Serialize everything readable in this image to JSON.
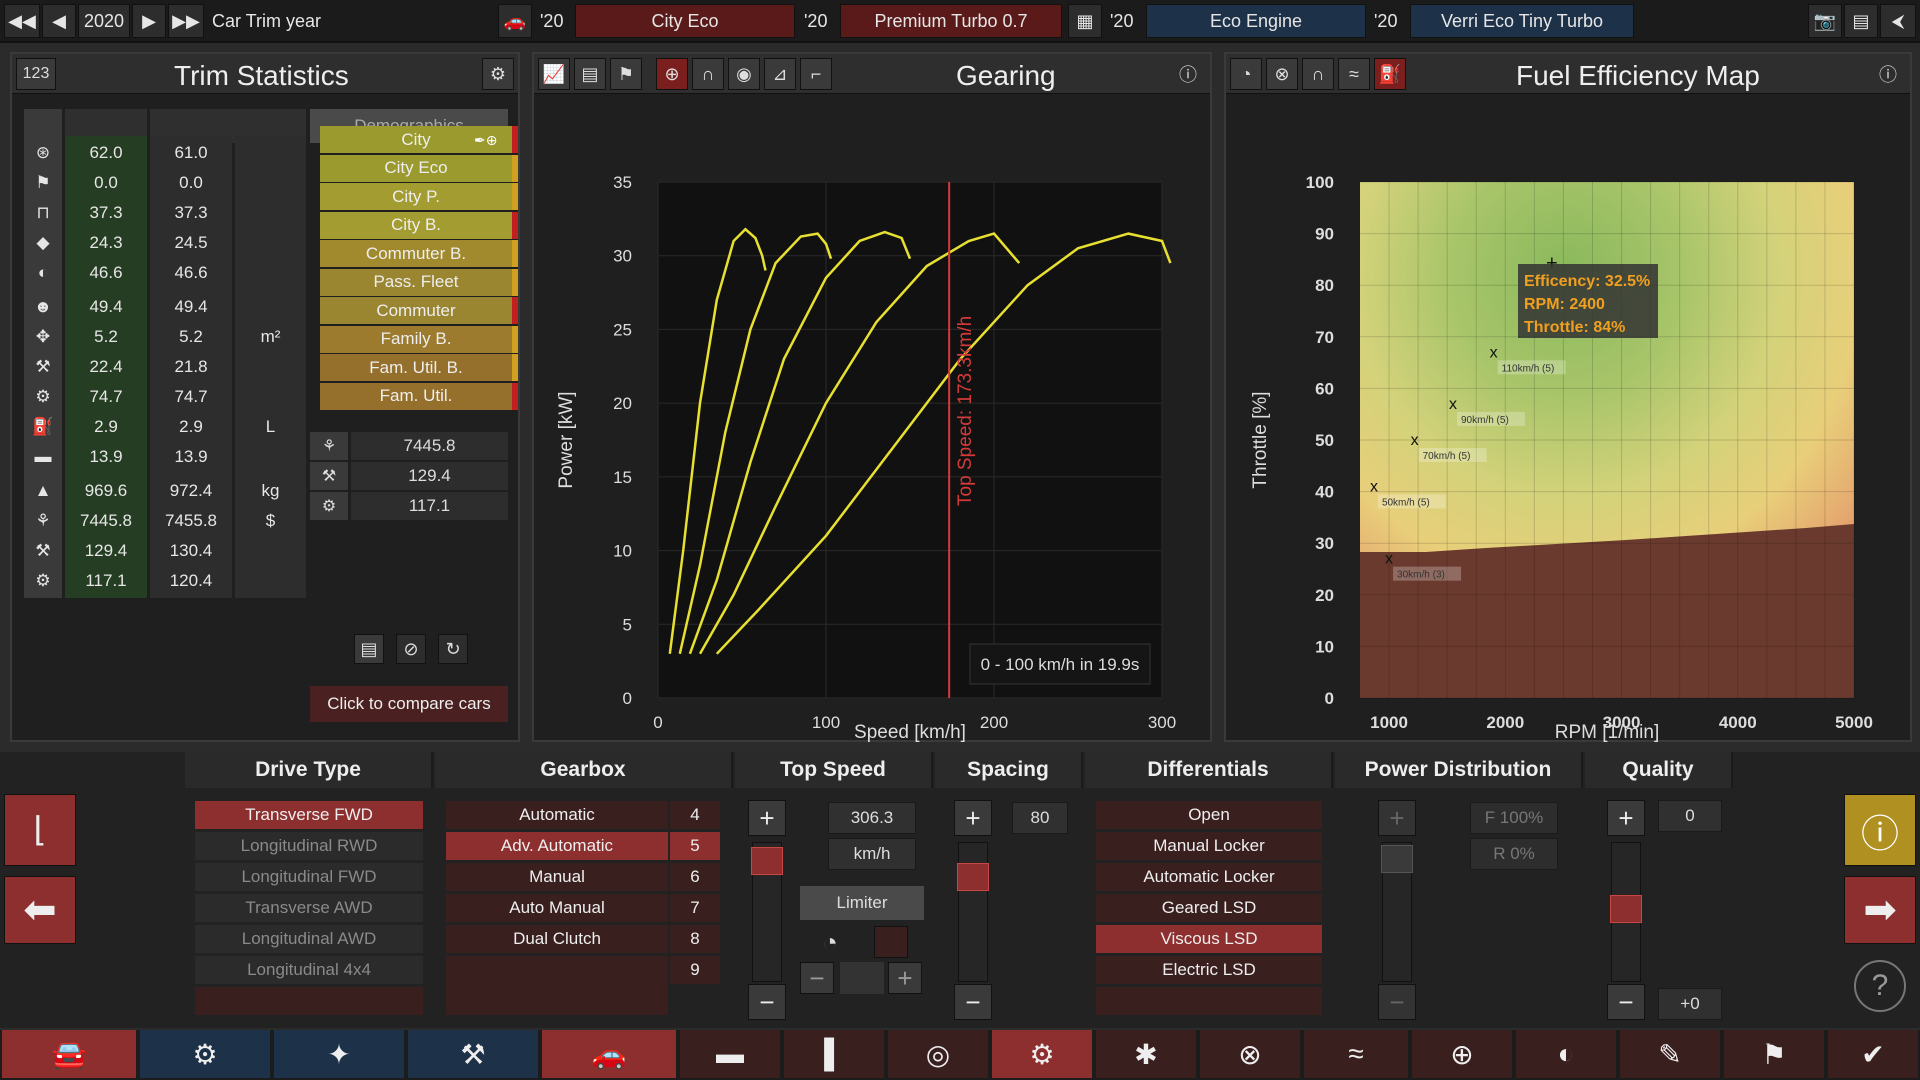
{
  "topbar": {
    "year": "2020",
    "year_label": "Car Trim year",
    "yr1": "'20",
    "trim": "City Eco",
    "yr2": "'20",
    "body": "Premium Turbo 0.7",
    "yr3": "'20",
    "engine_family": "Eco Engine",
    "yr4": "'20",
    "engine": "Verri Eco Tiny Turbo"
  },
  "stats": {
    "title": "Trim Statistics",
    "id": "123",
    "demographics_label": "Demographics",
    "rows": [
      {
        "icon": "steering-wheel-icon",
        "v1": "62.0",
        "v2": "61.0",
        "unit": ""
      },
      {
        "icon": "checkered-flag-icon",
        "v1": "0.0",
        "v2": "0.0",
        "unit": ""
      },
      {
        "icon": "seat-icon",
        "v1": "37.3",
        "v2": "37.3",
        "unit": ""
      },
      {
        "icon": "gem-icon",
        "v1": "24.3",
        "v2": "24.5",
        "unit": ""
      },
      {
        "icon": "safety-icon",
        "v1": "46.6",
        "v2": "46.6",
        "unit": ""
      },
      {
        "icon": "passengers-icon",
        "v1": "49.4",
        "v2": "49.4",
        "unit": ""
      },
      {
        "icon": "cargo-icon",
        "v1": "5.2",
        "v2": "5.2",
        "unit": "m²"
      },
      {
        "icon": "offroad-icon",
        "v1": "22.4",
        "v2": "21.8",
        "unit": ""
      },
      {
        "icon": "reliability-icon",
        "v1": "74.7",
        "v2": "74.7",
        "unit": ""
      },
      {
        "icon": "fuel-icon",
        "v1": "2.9",
        "v2": "2.9",
        "unit": "L"
      },
      {
        "icon": "truck-icon",
        "v1": "13.9",
        "v2": "13.9",
        "unit": ""
      },
      {
        "icon": "weight-icon",
        "v1": "969.6",
        "v2": "972.4",
        "unit": "kg"
      },
      {
        "icon": "cost-icon",
        "v1": "7445.8",
        "v2": "7455.8",
        "unit": "$"
      },
      {
        "icon": "engineering-icon",
        "v1": "129.4",
        "v2": "130.4",
        "unit": ""
      },
      {
        "icon": "production-icon",
        "v1": "117.1",
        "v2": "120.4",
        "unit": ""
      }
    ],
    "demos": [
      "City",
      "City Eco",
      "City P.",
      "City B.",
      "Commuter B.",
      "Pass. Fleet",
      "Commuter",
      "Family B.",
      "Fam. Util. B.",
      "Fam. Util."
    ],
    "demo_colors": [
      "#9a9a2e",
      "#9a9a2e",
      "#a39c30",
      "#a39c30",
      "#a18a2e",
      "#9a8530",
      "#9a8530",
      "#9c7a2e",
      "#94702c",
      "#94702c"
    ],
    "summary": [
      {
        "icon": "cost-icon",
        "value": "7445.8"
      },
      {
        "icon": "engineering-icon",
        "value": "129.4"
      },
      {
        "icon": "production-icon",
        "value": "117.1"
      }
    ],
    "compare": "Click to compare cars"
  },
  "gearing": {
    "title": "Gearing",
    "note": "0 - 100 km/h in 19.9s",
    "top_speed_label": "Top Speed: 173.3km/h"
  },
  "fuel": {
    "title": "Fuel Efficiency Map",
    "tip1": "Efficency: 32.5%",
    "tip2": "RPM: 2400",
    "tip3": "Throttle: 84%"
  },
  "chart_data": [
    {
      "type": "line",
      "title": "Gearing",
      "xlabel": "Speed [km/h]",
      "ylabel": "Power [kW]",
      "xlim": [
        0,
        300
      ],
      "ylim": [
        0,
        35
      ],
      "xticks": [
        0,
        100,
        200,
        300
      ],
      "yticks": [
        0,
        5,
        10,
        15,
        20,
        25,
        30,
        35
      ],
      "top_speed": 173.3,
      "series": [
        {
          "x": [
            7,
            15,
            25,
            35,
            45,
            52,
            58,
            62,
            64
          ],
          "y": [
            3,
            10,
            20,
            27,
            31,
            31.8,
            31.2,
            30,
            29
          ]
        },
        {
          "x": [
            13,
            25,
            40,
            55,
            70,
            85,
            95,
            100,
            103
          ],
          "y": [
            3,
            9,
            18,
            25,
            29.5,
            31.3,
            31.5,
            30.8,
            29.8
          ]
        },
        {
          "x": [
            19,
            35,
            55,
            75,
            100,
            120,
            135,
            145,
            150
          ],
          "y": [
            3,
            8,
            16,
            23,
            28.5,
            31,
            31.6,
            31.2,
            29.8
          ]
        },
        {
          "x": [
            25,
            45,
            70,
            100,
            130,
            160,
            185,
            200,
            215
          ],
          "y": [
            3,
            7,
            13,
            20,
            25.5,
            29.3,
            31,
            31.5,
            29.5
          ]
        },
        {
          "x": [
            35,
            60,
            100,
            140,
            180,
            220,
            250,
            280,
            300,
            305
          ],
          "y": [
            3,
            6,
            11,
            17,
            23,
            28,
            30.5,
            31.5,
            31,
            29.5
          ]
        }
      ]
    },
    {
      "type": "heatmap",
      "title": "Fuel Efficiency Map",
      "xlabel": "RPM [1/min]",
      "ylabel": "Throttle [%]",
      "xlim": [
        750,
        5000
      ],
      "ylim": [
        0,
        100
      ],
      "xticks": [
        1000,
        2000,
        3000,
        4000,
        5000
      ],
      "yticks": [
        0,
        10,
        20,
        30,
        40,
        50,
        60,
        70,
        80,
        90,
        100
      ],
      "points": [
        {
          "rpm": 2400,
          "throttle": 84,
          "label": ""
        },
        {
          "rpm": 1900,
          "throttle": 67,
          "label": "110km/h (5)"
        },
        {
          "rpm": 1550,
          "throttle": 57,
          "label": "90km/h (5)"
        },
        {
          "rpm": 1220,
          "throttle": 50,
          "label": "70km/h (5)"
        },
        {
          "rpm": 870,
          "throttle": 41,
          "label": "50km/h (5)"
        },
        {
          "rpm": 1000,
          "throttle": 27,
          "label": "30km/h (3)"
        }
      ]
    }
  ],
  "drive": {
    "title": "Drive Type",
    "options": [
      "Transverse FWD",
      "Longitudinal RWD",
      "Longitudinal FWD",
      "Transverse AWD",
      "Longitudinal AWD",
      "Longitudinal 4x4"
    ]
  },
  "gearbox": {
    "title": "Gearbox",
    "options": [
      "Automatic",
      "Adv. Automatic",
      "Manual",
      "Auto Manual",
      "Dual Clutch"
    ],
    "gears": [
      "4",
      "5",
      "6",
      "7",
      "8",
      "9"
    ]
  },
  "topspeed": {
    "title": "Top Speed",
    "value": "306.3",
    "unit": "km/h",
    "limiter": "Limiter"
  },
  "spacing": {
    "title": "Spacing",
    "value": "80"
  },
  "diff": {
    "title": "Differentials",
    "options": [
      "Open",
      "Manual Locker",
      "Automatic Locker",
      "Geared LSD",
      "Viscous LSD",
      "Electric LSD"
    ]
  },
  "power": {
    "title": "Power Distribution",
    "front": "F 100%",
    "rear": "R 0%"
  },
  "quality": {
    "title": "Quality",
    "value": "0",
    "delta": "+0"
  }
}
